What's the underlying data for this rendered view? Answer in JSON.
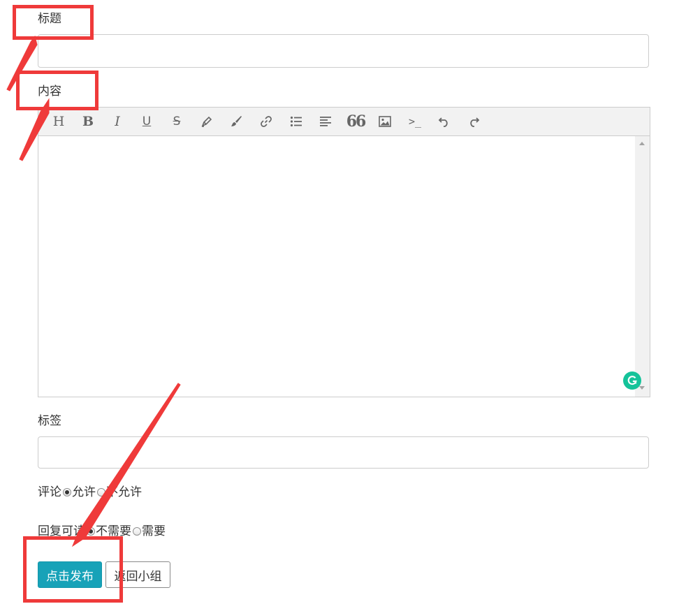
{
  "form": {
    "title_label": "标题",
    "title_value": "",
    "content_label": "内容",
    "tags_label": "标签",
    "tags_value": ""
  },
  "toolbar": {
    "buttons": [
      {
        "icon": "heading-icon",
        "glyph": "H"
      },
      {
        "icon": "bold-icon",
        "glyph": "B"
      },
      {
        "icon": "italic-icon",
        "glyph": "I"
      },
      {
        "icon": "underline-icon",
        "glyph": "U"
      },
      {
        "icon": "strikethrough-icon",
        "glyph": "S"
      },
      {
        "icon": "highlighter-icon"
      },
      {
        "icon": "brush-icon"
      },
      {
        "icon": "link-icon"
      },
      {
        "icon": "unordered-list-icon"
      },
      {
        "icon": "align-left-icon"
      },
      {
        "icon": "quote-icon",
        "glyph": "66"
      },
      {
        "icon": "image-icon"
      },
      {
        "icon": "code-icon",
        "glyph": ">_"
      },
      {
        "icon": "undo-icon"
      },
      {
        "icon": "redo-icon"
      }
    ]
  },
  "comment": {
    "label": "评论",
    "options": [
      {
        "label": "允许",
        "checked": true
      },
      {
        "label": "不允许",
        "checked": false
      }
    ]
  },
  "reply_visible": {
    "label": "回复可读",
    "options": [
      {
        "label": "不需要",
        "checked": true
      },
      {
        "label": "需要",
        "checked": false
      }
    ]
  },
  "actions": {
    "publish_label": "点击发布",
    "back_label": "返回小组"
  },
  "colors": {
    "primary": "#17a2b8",
    "annotation": "#ef3a3a",
    "grammarly": "#15c39a"
  }
}
